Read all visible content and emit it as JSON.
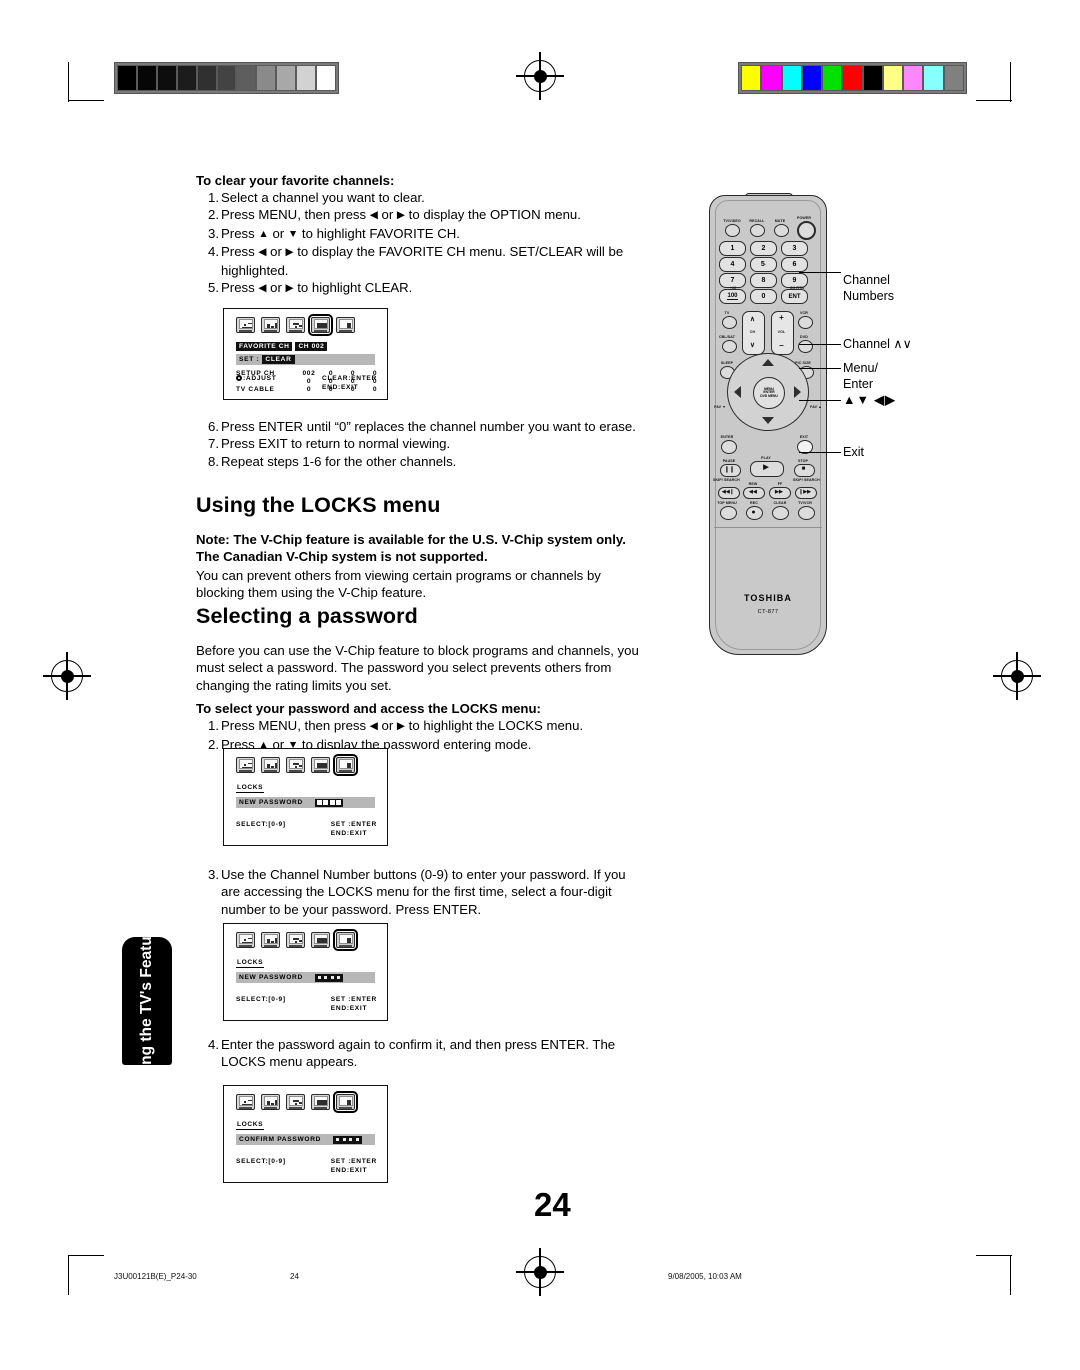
{
  "document": {
    "page_number": "24",
    "side_tab": "Using the TV's Features",
    "footer": {
      "file_id": "J3U00121B(E)_P24-30",
      "page": "24",
      "timestamp": "9/08/2005, 10:03 AM"
    }
  },
  "colorbars": {
    "grayscale": [
      "#000000",
      "#060606",
      "#0d0d0d",
      "#1c1c1c",
      "#303030",
      "#434343",
      "#5e5e5e",
      "#8a8a8a",
      "#a8a8a8",
      "#d2d2d2",
      "#ffffff"
    ],
    "color": [
      "#ffff00",
      "#ff00ff",
      "#00ffff",
      "#0000ff",
      "#00e000",
      "#ff0000",
      "#000000",
      "#ffff88",
      "#ff88ff",
      "#88ffff",
      "#808080"
    ]
  },
  "content": {
    "clear_favorites": {
      "heading": "To clear your favorite channels:",
      "steps": [
        {
          "n": "1.",
          "text": "Select a channel you want to clear."
        },
        {
          "n": "2.",
          "text": "Press MENU, then press ◀ or ▶ to display the OPTION menu."
        },
        {
          "n": "3.",
          "text": "Press ▲ or ▼ to highlight FAVORITE CH."
        },
        {
          "n": "4.",
          "text": "Press ◀ or ▶ to display the FAVORITE CH menu. SET/CLEAR will be highlighted."
        },
        {
          "n": "5.",
          "text": "Press ◀ or ▶ to highlight CLEAR."
        }
      ],
      "steps_after": [
        {
          "n": "6.",
          "text": "Press ENTER until “0” replaces the channel number you want to erase."
        },
        {
          "n": "7.",
          "text": "Press EXIT to return to normal viewing."
        },
        {
          "n": "8.",
          "text": "Repeat steps 1-6 for the other channels."
        }
      ]
    },
    "locks_section": {
      "title": "Using the LOCKS menu",
      "note": "Note: The V-Chip feature is available for the U.S. V-Chip system only. The Canadian V-Chip system is not supported.",
      "body": "You can prevent others from viewing certain programs or channels by blocking them using the V-Chip feature."
    },
    "password_section": {
      "title": "Selecting a password",
      "intro": "Before you can use the V-Chip feature to block programs and channels, you must select a password. The password you select prevents others from changing the rating limits you set.",
      "heading": "To select your password and access the LOCKS menu:",
      "steps": [
        {
          "n": "1.",
          "text": "Press MENU, then press ◀ or ▶ to highlight the LOCKS menu."
        },
        {
          "n": "2.",
          "text": "Press ▲ or ▼ to display the password entering mode."
        }
      ],
      "step3": {
        "n": "3.",
        "text": "Use the Channel Number buttons (0-9) to enter your password. If you are accessing the LOCKS menu for the first time, select a four-digit number to be your password. Press ENTER."
      },
      "step4": {
        "n": "4.",
        "text": "Enter the password again to confirm it, and then press ENTER. The LOCKS menu appears."
      }
    }
  },
  "osd_screens": [
    {
      "id": "favorite-ch",
      "selected_icon": 3,
      "title_left": "FAVORITE CH",
      "title_right": "CH 002",
      "row_label": "SET :",
      "row_value": "CLEAR",
      "table": {
        "rows": [
          {
            "label": "SETUP CH",
            "values": [
              "002",
              "0",
              "0",
              "0"
            ]
          },
          {
            "label": "",
            "values": [
              "0",
              "0",
              "0",
              "0"
            ]
          },
          {
            "label": "TV CABLE",
            "values": [
              "0",
              "0",
              "0",
              "0"
            ]
          }
        ]
      },
      "footer_left": ":ADJUST",
      "footer_right_1": "CLEAR:ENTER",
      "footer_right_2": "END:EXIT"
    },
    {
      "id": "locks-new-password-empty",
      "selected_icon": 4,
      "title_left": "LOCKS",
      "row_label": "NEW PASSWORD",
      "password_digits": 4,
      "password_filled": false,
      "footer_left": "SELECT:[0-9]",
      "footer_right_1": "SET :ENTER",
      "footer_right_2": "END:EXIT"
    },
    {
      "id": "locks-new-password-filled",
      "selected_icon": 4,
      "title_left": "LOCKS",
      "row_label": "NEW PASSWORD",
      "password_digits": 4,
      "password_filled": true,
      "footer_left": "SELECT:[0-9]",
      "footer_right_1": "SET :ENTER",
      "footer_right_2": "END:EXIT"
    },
    {
      "id": "locks-confirm-password",
      "selected_icon": 4,
      "title_left": "LOCKS",
      "row_label": "CONFIRM PASSWORD",
      "password_digits": 4,
      "password_filled": true,
      "footer_left": "SELECT:[0-9]",
      "footer_right_1": "SET :ENTER",
      "footer_right_2": "END:EXIT"
    }
  ],
  "remote": {
    "brand": "TOSHIBA",
    "model": "CT-877",
    "top_row": [
      "TV/VIDEO",
      "RECALL",
      "MUTE",
      "POWER"
    ],
    "keypad": [
      "1",
      "2",
      "3",
      "4",
      "5",
      "6",
      "7",
      "8",
      "9",
      "100",
      "0",
      "ENT"
    ],
    "keypad_sub": {
      "hundred": "+10",
      "ent": "CH RTN"
    },
    "device_row": [
      "TV",
      "VCR"
    ],
    "device_row2": [
      "CBL/SAT",
      "DVD"
    ],
    "updown": {
      "ch": "CH",
      "vol": "VOL"
    },
    "mid_row": [
      "SLEEP",
      "PIC SIZE"
    ],
    "pad_center": [
      "MENU",
      "ENTER",
      "DVD MENU"
    ],
    "fav": {
      "left": "FAV ▼",
      "right": "FAV ▲"
    },
    "enter_exit": [
      "ENTER",
      "EXIT"
    ],
    "transport": [
      "PAUSE",
      "PLAY",
      "STOP"
    ],
    "transport2": [
      "SKIP/ SEARCH",
      "REW",
      "FF",
      "SKIP/ SEARCH"
    ],
    "bottom_row": [
      "TOP MENU",
      "REC",
      "CLEAR",
      "TV/VCR"
    ]
  },
  "callouts": [
    {
      "id": "channel-numbers",
      "text": "Channel\nNumbers"
    },
    {
      "id": "channel-updown",
      "text": "Channel ∧∨"
    },
    {
      "id": "menu-enter",
      "text": "Menu/\nEnter"
    },
    {
      "id": "arrows",
      "text": "▲▼ ◀▶"
    },
    {
      "id": "exit",
      "text": "Exit"
    }
  ]
}
